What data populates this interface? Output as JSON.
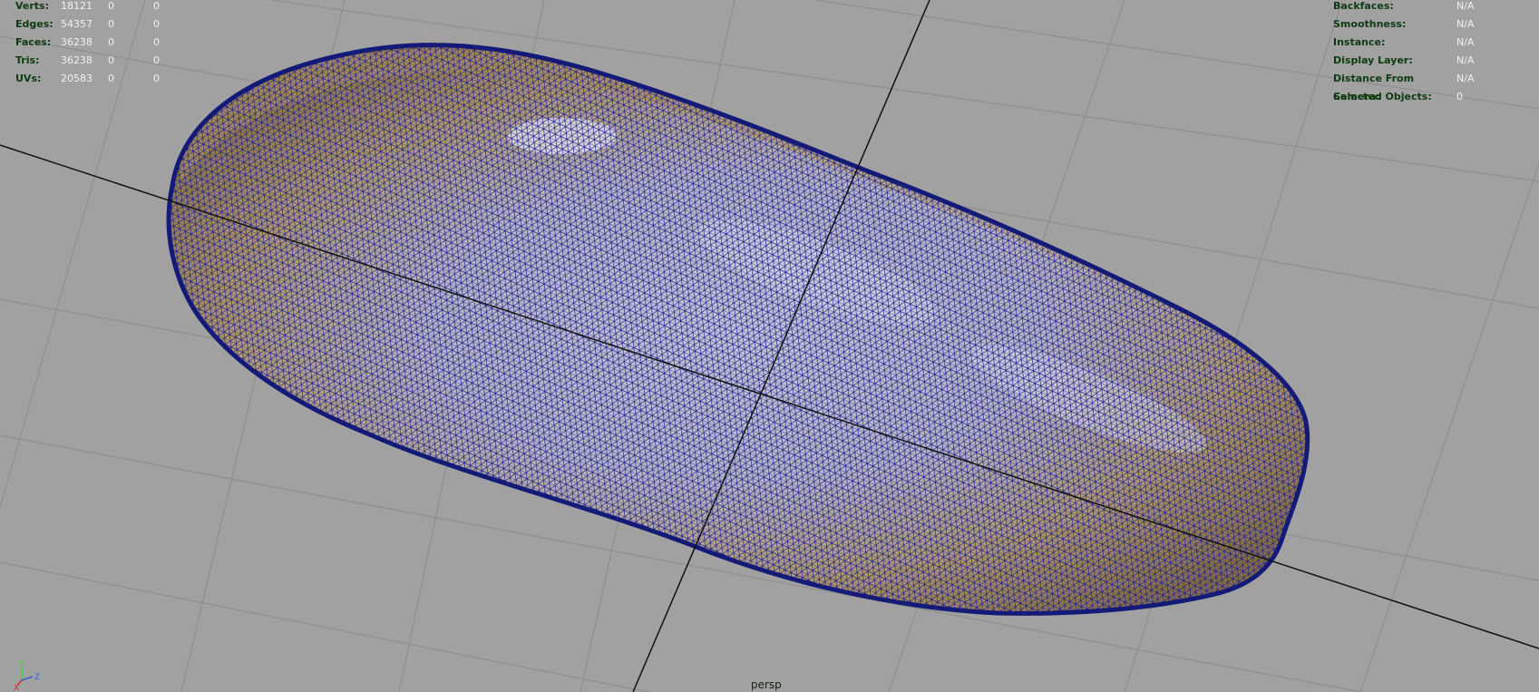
{
  "view": {
    "camera": "persp"
  },
  "stats": {
    "rows": [
      {
        "label": "Verts:",
        "values": [
          "18121",
          "0",
          "0"
        ]
      },
      {
        "label": "Edges:",
        "values": [
          "54357",
          "0",
          "0"
        ]
      },
      {
        "label": "Faces:",
        "values": [
          "36238",
          "0",
          "0"
        ]
      },
      {
        "label": "Tris:",
        "values": [
          "36238",
          "0",
          "0"
        ]
      },
      {
        "label": "UVs:",
        "values": [
          "20583",
          "0",
          "0"
        ]
      }
    ]
  },
  "info": {
    "rows": [
      {
        "label": "Backfaces:",
        "value": "N/A"
      },
      {
        "label": "Smoothness:",
        "value": "N/A"
      },
      {
        "label": "Instance:",
        "value": "N/A"
      },
      {
        "label": "Display Layer:",
        "value": "N/A"
      },
      {
        "label": "Distance From Camera:",
        "value": "N/A"
      },
      {
        "label": "Selected Objects:",
        "value": "0"
      }
    ]
  },
  "gizmo": {
    "x_label": "X",
    "y_label": "Y",
    "z_label": "Z"
  },
  "colors": {
    "background": "#a1a1a1",
    "grid": "#8d8d8d",
    "axis": "#111111",
    "wire": "#1a1f8a",
    "surface_gold": "#b59660",
    "surface_blue": "#b8bcd8"
  }
}
